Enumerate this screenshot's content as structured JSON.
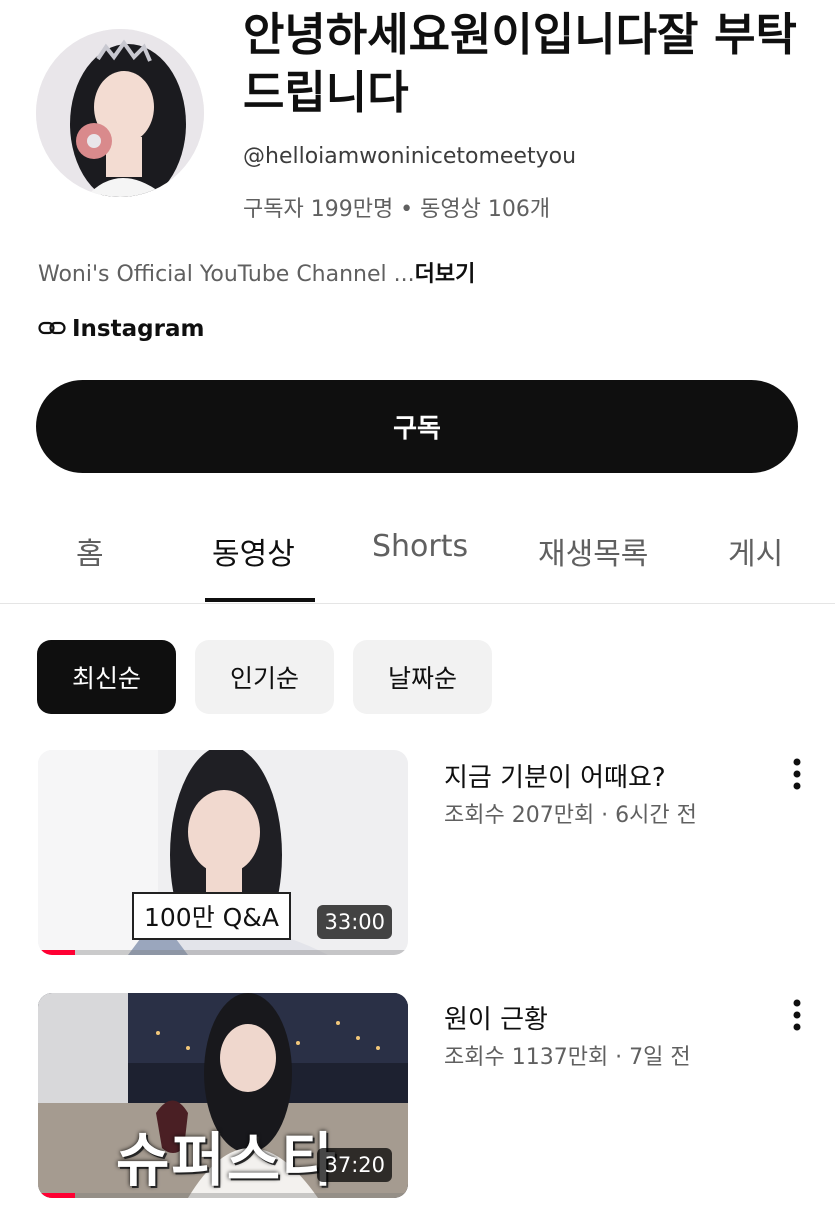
{
  "channel": {
    "title": "안녕하세요원이입니다잘 부탁드립니다",
    "handle": "@helloiamwoninicetomeetyou",
    "stats": "구독자 199만명 • 동영상 106개",
    "description": "Woni's Official YouTube Channel ...",
    "more_label": "더보기",
    "link_label": "Instagram",
    "subscribe_label": "구독"
  },
  "tabs": [
    {
      "label": "홈"
    },
    {
      "label": "동영상"
    },
    {
      "label": "Shorts"
    },
    {
      "label": "재생목록"
    },
    {
      "label": "게시"
    }
  ],
  "active_tab": "동영상",
  "sort_chips": [
    {
      "label": "최신순"
    },
    {
      "label": "인기순"
    },
    {
      "label": "날짜순"
    }
  ],
  "active_chip": "최신순",
  "videos": [
    {
      "title": "지금 기분이 어때요?",
      "meta": "조회수 207만회 · 6시간 전",
      "duration": "33:00",
      "overlay_text": "100만 Q&A",
      "watch_progress": 0.1
    },
    {
      "title": "원이 근황",
      "meta": "조회수 1137만회 · 7일 전",
      "duration": "37:20",
      "overlay_text": "슈퍼스타",
      "watch_progress": 0.1
    }
  ],
  "colors": {
    "primary_text": "#0f0f0f",
    "secondary_text": "#606060",
    "accent_red": "#ff0033",
    "chip_bg": "#f2f2f2"
  },
  "icons": {
    "link": "link-icon",
    "more": "more-vertical-icon"
  }
}
